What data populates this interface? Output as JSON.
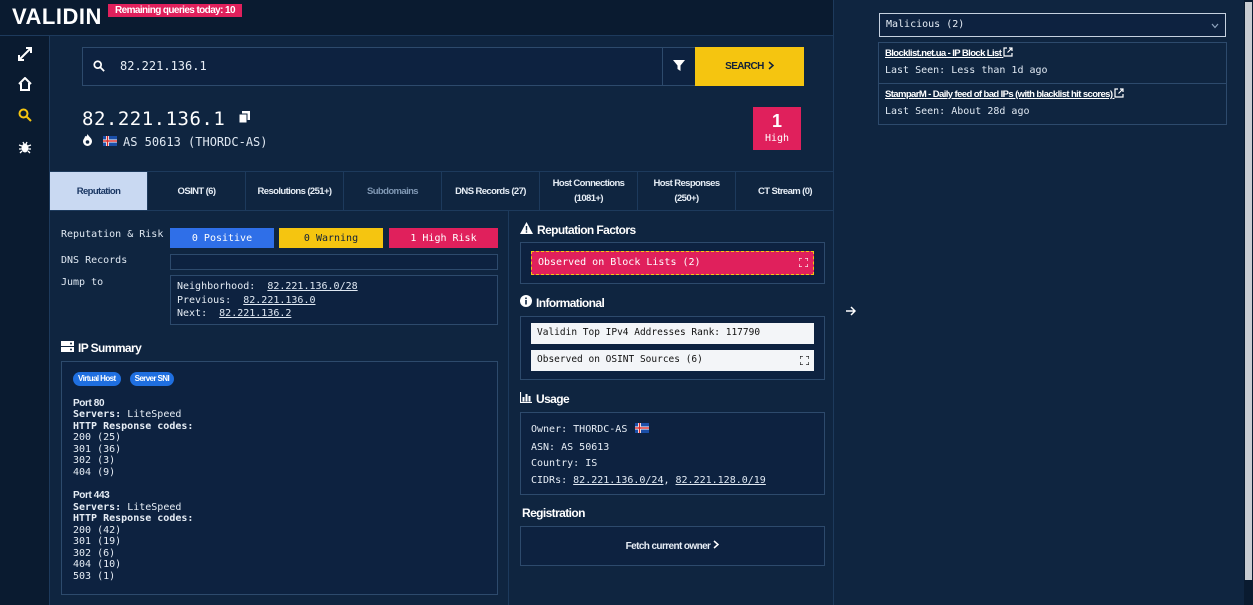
{
  "app": {
    "logo": "VALIDIN",
    "queries_badge": "Remaining queries today: 10"
  },
  "nav": {
    "icons": [
      "expand-icon",
      "home-icon",
      "search-icon",
      "bug-icon"
    ]
  },
  "search": {
    "value": "82.221.136.1",
    "button_label": "SEARCH"
  },
  "ip": {
    "address": "82.221.136.1",
    "as_text": "AS 50613 (THORDC-AS)"
  },
  "risk": {
    "number": "1",
    "level": "High"
  },
  "tabs": [
    {
      "label": "Reputation"
    },
    {
      "label": "OSINT (6)"
    },
    {
      "label": "Resolutions (251+)"
    },
    {
      "label": "Subdomains"
    },
    {
      "label": "DNS Records (27)"
    },
    {
      "label": "Host Connections (1081+)"
    },
    {
      "label": "Host Responses (250+)"
    },
    {
      "label": "CT Stream (0)"
    }
  ],
  "reputation": {
    "label": "Reputation & Risk",
    "positive": "0 Positive",
    "warning": "0 Warning",
    "high_risk": "1 High Risk",
    "dns_label": "DNS Records",
    "jump_label": "Jump to",
    "jump": {
      "neighborhood_label": "Neighborhood:",
      "neighborhood": "82.221.136.0/28",
      "previous_label": "Previous:",
      "previous": "82.221.136.0",
      "next_label": "Next:",
      "next": "82.221.136.2"
    }
  },
  "summary": {
    "title": "IP Summary",
    "tags": [
      "Virtual Host",
      "Server SNI"
    ],
    "ports": [
      {
        "title": "Port 80",
        "servers_label": "Servers:",
        "servers": "LiteSpeed",
        "codes_label": "HTTP Response codes:",
        "codes": [
          "200 (25)",
          "301 (36)",
          "302 (3)",
          "404 (9)"
        ]
      },
      {
        "title": "Port 443",
        "servers_label": "Servers:",
        "servers": "LiteSpeed",
        "codes_label": "HTTP Response codes:",
        "codes": [
          "200 (42)",
          "301 (19)",
          "302 (6)",
          "404 (10)",
          "503 (1)"
        ]
      }
    ]
  },
  "factors": {
    "title": "Reputation Factors",
    "blocklist": "Observed on Block Lists (2)"
  },
  "informational": {
    "title": "Informational",
    "rank": "Validin Top IPv4 Addresses Rank: 117790",
    "osint": "Observed on OSINT Sources (6)"
  },
  "usage": {
    "title": "Usage",
    "owner_label": "Owner:",
    "owner": "THORDC-AS",
    "asn_label": "ASN:",
    "asn": "AS 50613",
    "country_label": "Country:",
    "country": "IS",
    "cidrs_label": "CIDRs:",
    "cidr1": "82.221.136.0/24",
    "cidr2": "82.221.128.0/19"
  },
  "registration": {
    "title": "Registration",
    "button": "Fetch current owner"
  },
  "panel": {
    "select": "Malicious (2)",
    "entries": [
      {
        "title": "Blocklist.net.ua - IP Block List",
        "seen": "Last Seen: Less than 1d ago"
      },
      {
        "title": "StamparM - Daily feed of bad IPs (with blacklist hit scores)",
        "seen": "Last Seen: About 28d ago"
      }
    ]
  },
  "colors": {
    "accent_yellow": "#f5c510",
    "risk_red": "#e0205c",
    "positive_blue": "#2f6fe8",
    "bg": "#0f2540"
  }
}
